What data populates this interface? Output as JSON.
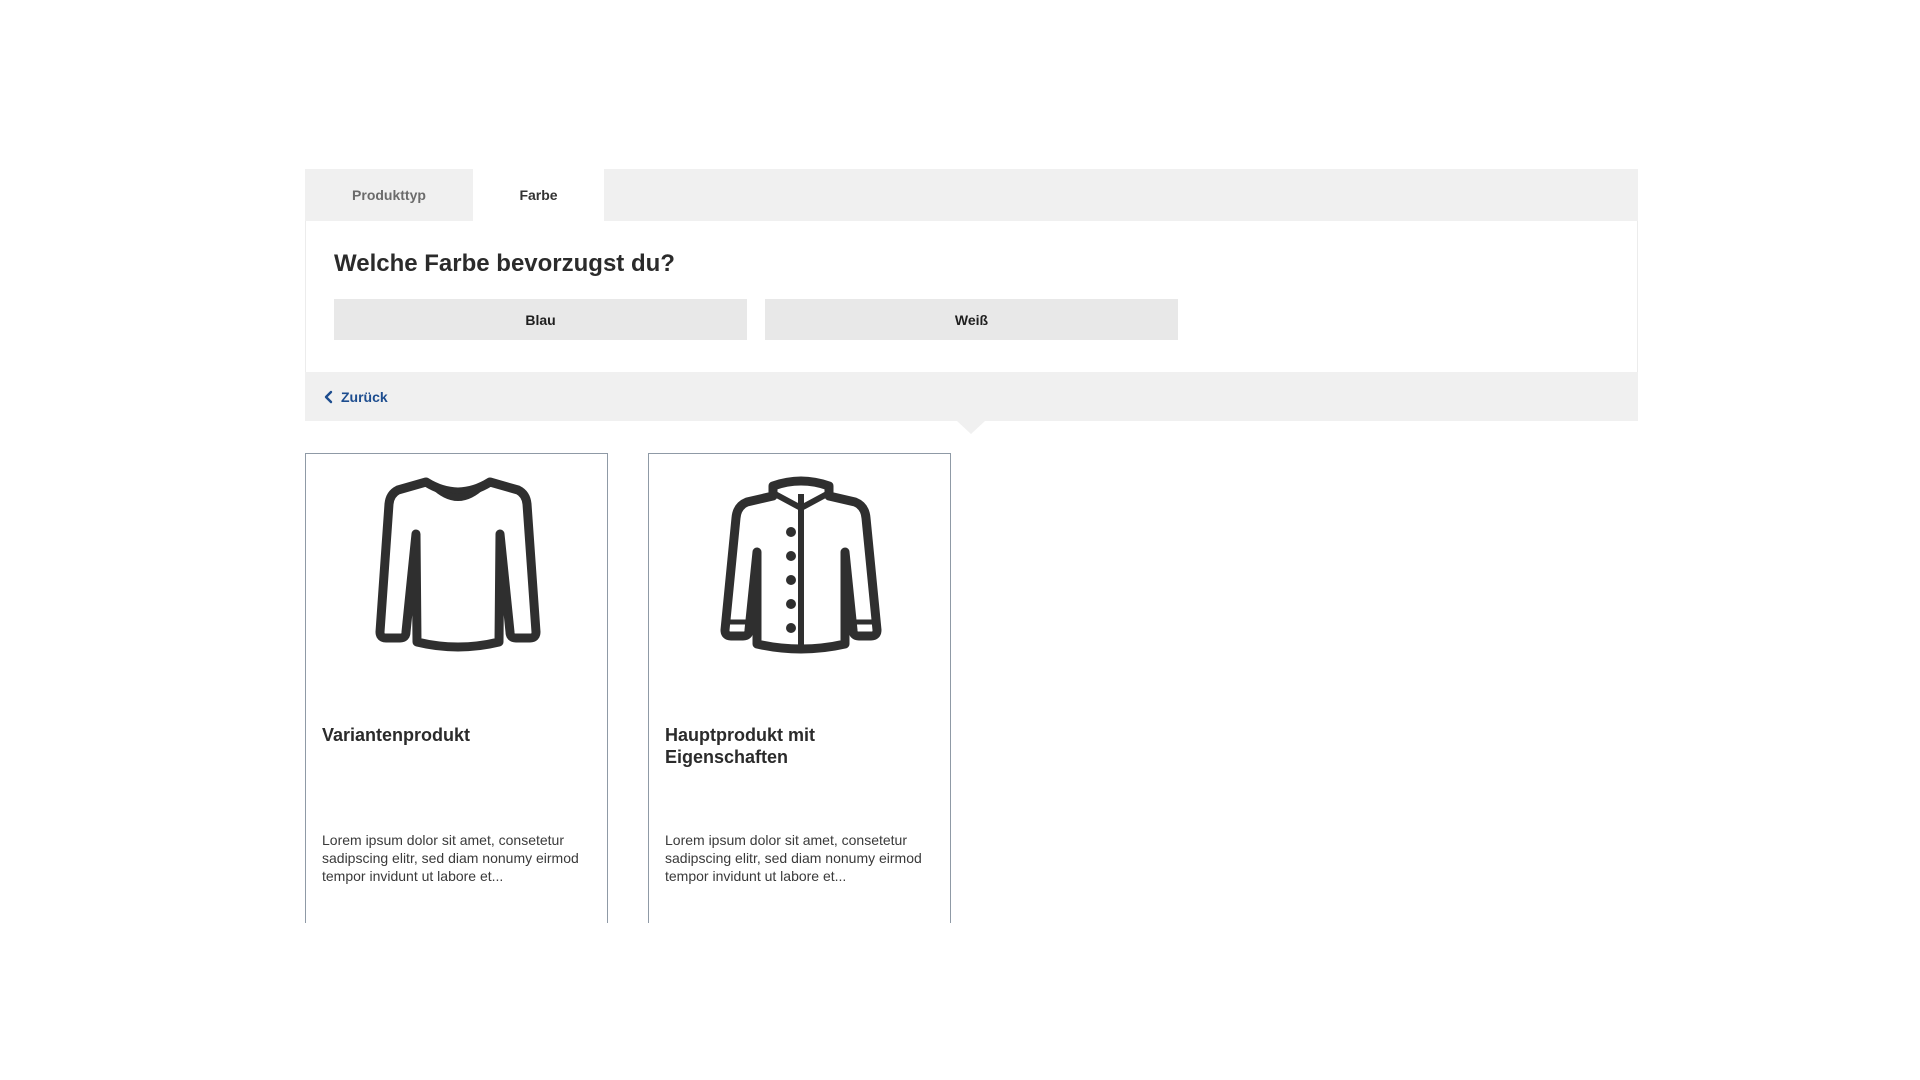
{
  "wizard": {
    "tabs": [
      {
        "label": "Produkttyp",
        "active": false
      },
      {
        "label": "Farbe",
        "active": true
      }
    ],
    "question": "Welche Farbe bevorzugst du?",
    "answers": [
      "Blau",
      "Weiß"
    ],
    "back_label": "Zurück"
  },
  "products": [
    {
      "title": "Variantenprodukt",
      "description": "Lorem ipsum dolor sit amet, consetetur sadipscing elitr, sed diam nonumy eirmod tempor invidunt ut labore et...",
      "icon": "longsleeve-shirt-icon"
    },
    {
      "title": "Hauptprodukt mit Eigenschaften",
      "description": "Lorem ipsum dolor sit amet, consetetur sadipscing elitr, sed diam nonumy eirmod tempor invidunt ut labore et...",
      "icon": "button-jacket-icon"
    }
  ],
  "colors": {
    "tabbar_bg": "#f0f0f0",
    "answer_bg": "#e8e8e8",
    "link": "#1d4d8f",
    "card_border": "#8f9aa6"
  }
}
